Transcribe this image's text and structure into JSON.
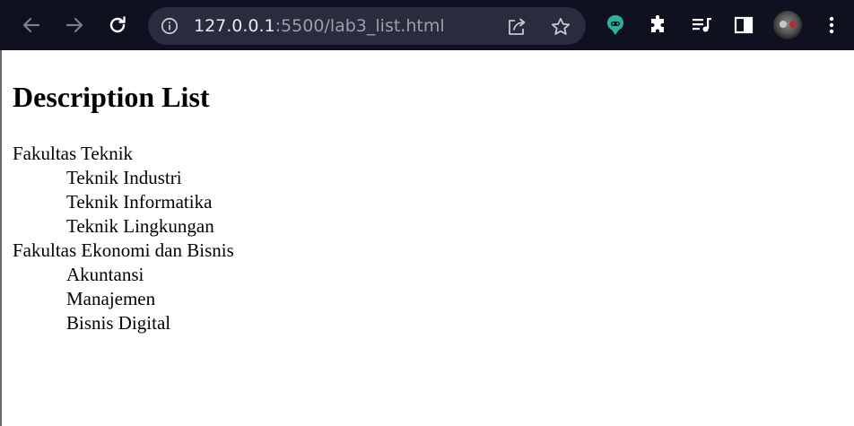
{
  "browser": {
    "address_host": "127.0.0.1",
    "address_rest": ":5500/lab3_list.html",
    "icons": {
      "back": "back-arrow-icon",
      "forward": "forward-arrow-icon",
      "reload": "reload-icon",
      "site_info": "info-icon",
      "share": "share-icon",
      "bookmark": "star-icon",
      "extension": "extension-icon",
      "extensions": "puzzle-icon",
      "media": "media-queue-icon",
      "side_panel": "side-panel-icon",
      "profile": "avatar",
      "menu": "kebab-menu-icon"
    },
    "colors": {
      "toolbar_bg": "#0f1020",
      "omnibox_bg": "#2a2b3d",
      "extension_accent": "#2bb39a"
    }
  },
  "page": {
    "heading": "Description List",
    "groups": [
      {
        "term": "Fakultas Teknik",
        "descriptions": [
          "Teknik Industri",
          "Teknik Informatika",
          "Teknik Lingkungan"
        ]
      },
      {
        "term": "Fakultas Ekonomi dan Bisnis",
        "descriptions": [
          "Akuntansi",
          "Manajemen",
          "Bisnis Digital"
        ]
      }
    ]
  }
}
